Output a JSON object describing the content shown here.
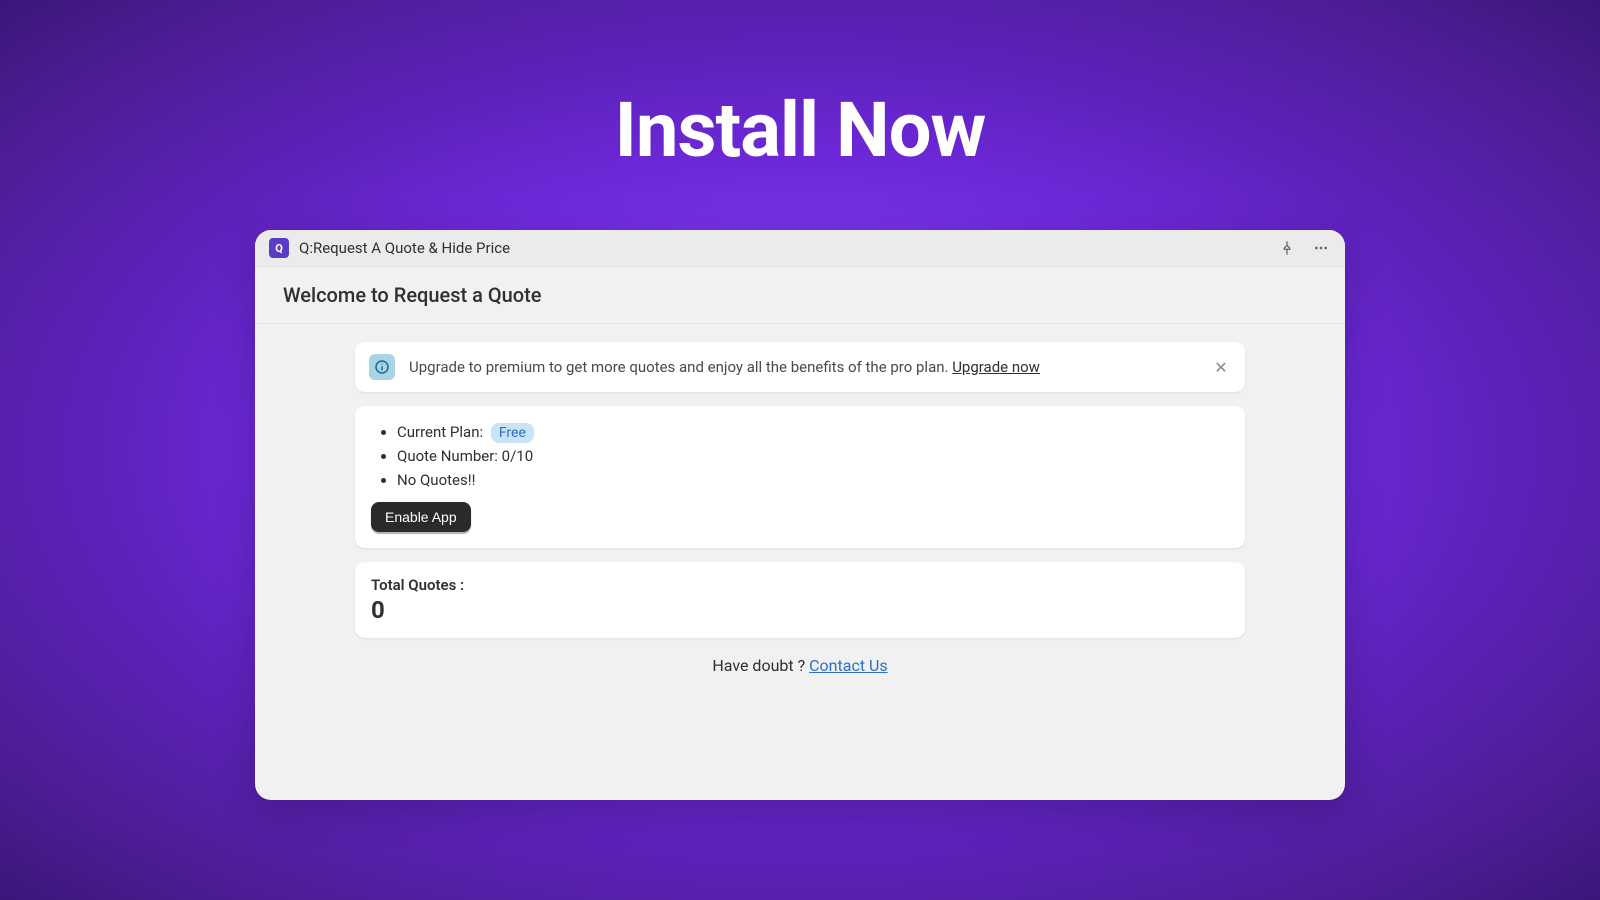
{
  "page": {
    "title": "Install Now"
  },
  "header": {
    "logo_letter": "Q",
    "app_name": "Q:Request A Quote & Hide Price"
  },
  "welcome": {
    "title": "Welcome to Request a Quote"
  },
  "banner": {
    "message": "Upgrade to premium to get more quotes and enjoy all the benefits of the pro plan. ",
    "upgrade_link": "Upgrade now"
  },
  "plan": {
    "current_label": "Current Plan:",
    "current_badge": "Free",
    "quote_number_label": "Quote Number: 0/10",
    "no_quotes_label": "No Quotes!!",
    "enable_button": "Enable App"
  },
  "quotes": {
    "label": "Total Quotes :",
    "value": "0"
  },
  "contact": {
    "prefix": "Have doubt ? ",
    "link": "Contact Us"
  }
}
